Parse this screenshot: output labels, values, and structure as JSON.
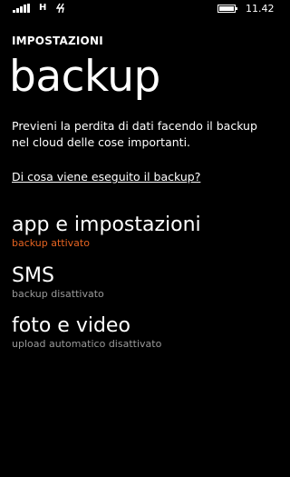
{
  "status_bar": {
    "network_type": "H",
    "time": "11.42"
  },
  "header": {
    "app_title": "IMPOSTAZIONI",
    "page_title": "backup"
  },
  "description": "Previeni la perdita di dati facendo il backup nel cloud delle cose importanti.",
  "help_link": "Di cosa viene eseguito il backup?",
  "items": [
    {
      "title": "app e impostazioni",
      "subtitle": "backup attivato",
      "accent": true
    },
    {
      "title": "SMS",
      "subtitle": "backup disattivato",
      "accent": false
    },
    {
      "title": "foto e video",
      "subtitle": "upload automatico disattivato",
      "accent": false
    }
  ],
  "colors": {
    "background": "#000000",
    "text": "#ffffff",
    "accent": "#e56321",
    "secondary": "#9a9a9a"
  },
  "icons": [
    "signal-strength-icon",
    "data-transfer-icon",
    "battery-icon"
  ]
}
